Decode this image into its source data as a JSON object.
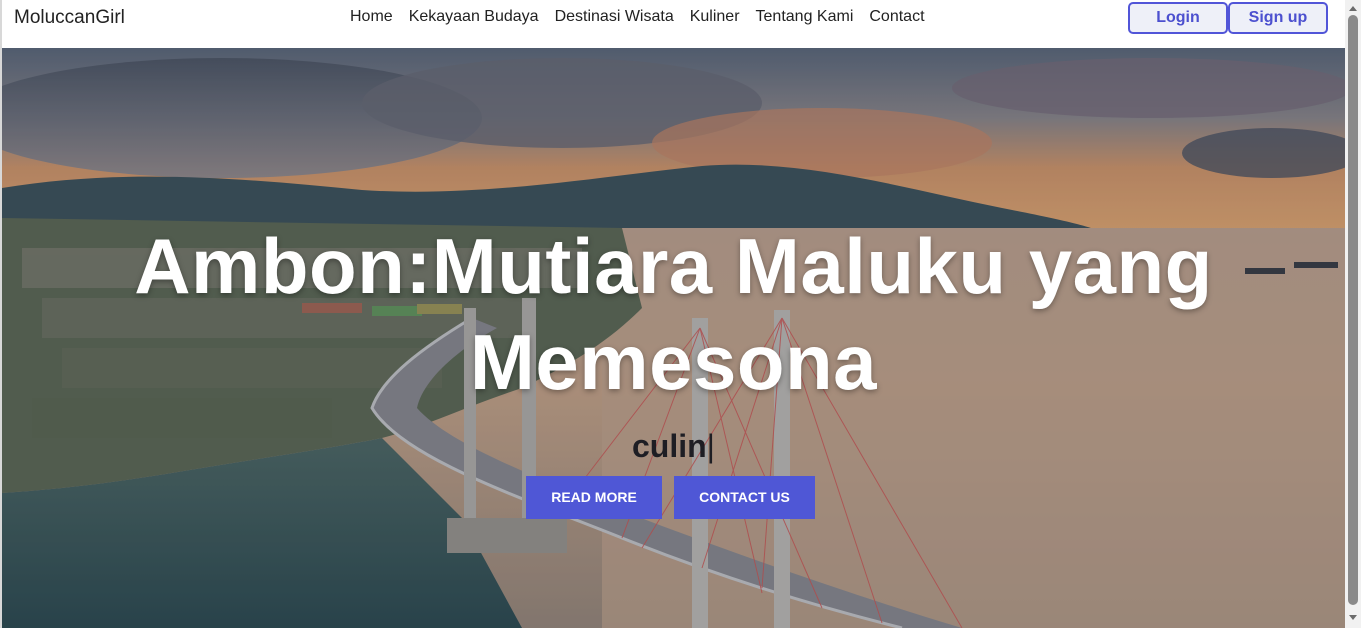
{
  "navbar": {
    "brand": "MoluccanGirl",
    "links": [
      "Home",
      "Kekayaan Budaya",
      "Destinasi Wisata",
      "Kuliner",
      "Tentang Kami",
      "Contact"
    ],
    "login_label": "Login",
    "signup_label": "Sign up"
  },
  "hero": {
    "title_line1": "Ambon:Mutiara Maluku yang",
    "title_line2": "Memesona",
    "typed_text": "culin",
    "cursor": "|",
    "read_more_label": "READ MORE",
    "contact_label": "CONTACT US"
  },
  "colors": {
    "accent": "#4f57d6",
    "button_border": "#5155d8"
  }
}
